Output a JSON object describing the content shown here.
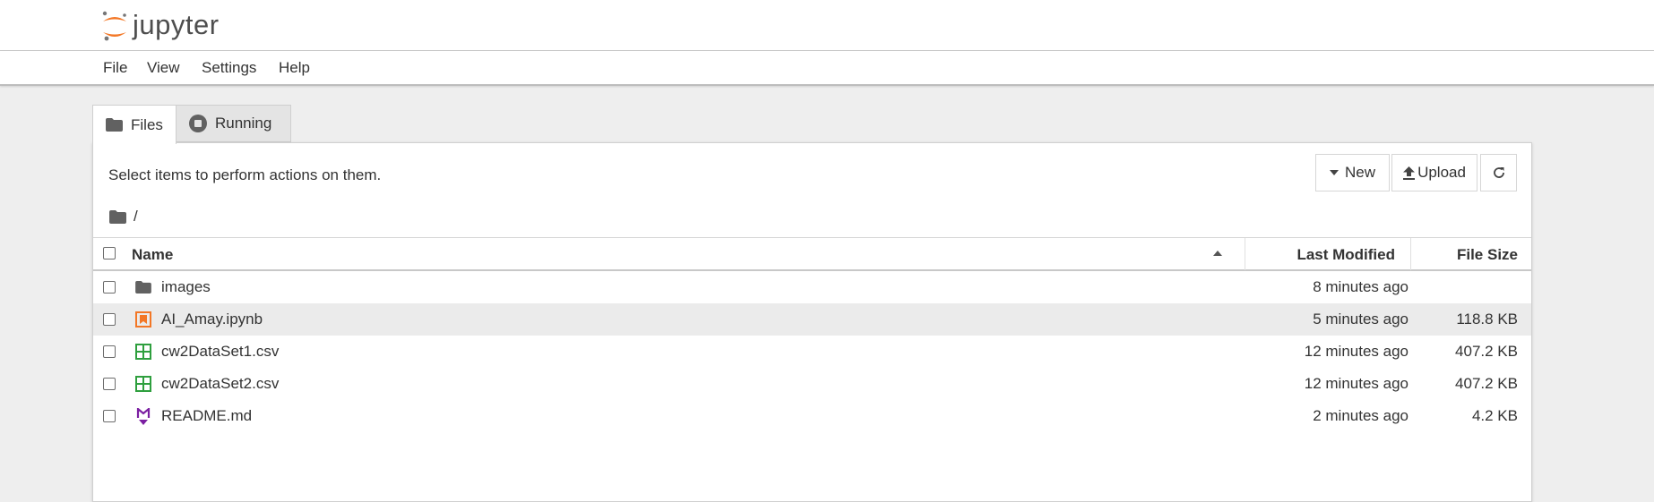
{
  "app": {
    "name": "jupyter"
  },
  "menu": [
    "File",
    "View",
    "Settings",
    "Help"
  ],
  "tabs": {
    "files": "Files",
    "running": "Running"
  },
  "panel": {
    "hint": "Select items to perform actions on them.",
    "buttons": {
      "new": "New",
      "upload": "Upload"
    },
    "breadcrumb": "/"
  },
  "table": {
    "headers": {
      "name": "Name",
      "modified": "Last Modified",
      "size": "File Size"
    },
    "rows": [
      {
        "name": "images",
        "modified": "8 minutes ago",
        "size": "",
        "icon": "folder-icon"
      },
      {
        "name": "AI_Amay.ipynb",
        "modified": "5 minutes ago",
        "size": "118.8 KB",
        "icon": "notebook-icon"
      },
      {
        "name": "cw2DataSet1.csv",
        "modified": "12 minutes ago",
        "size": "407.2 KB",
        "icon": "spreadsheet-icon"
      },
      {
        "name": "cw2DataSet2.csv",
        "modified": "12 minutes ago",
        "size": "407.2 KB",
        "icon": "spreadsheet-icon"
      },
      {
        "name": "README.md",
        "modified": "2 minutes ago",
        "size": "4.2 KB",
        "icon": "markdown-icon"
      }
    ]
  },
  "colors": {
    "jupyter_orange": "#F37726",
    "csv_green": "#2E9F3E",
    "markdown_purple": "#7B1FA2",
    "selected_row": "#EBEBEB"
  }
}
